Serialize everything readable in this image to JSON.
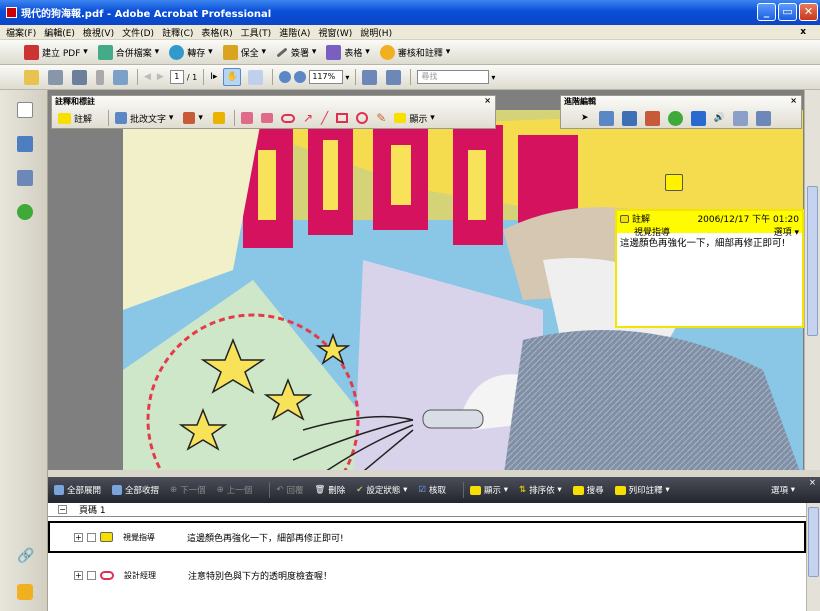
{
  "window": {
    "title": "現代的狗海報.pdf - Adobe Acrobat Professional",
    "close_doc": "x"
  },
  "menu": [
    "檔案(F)",
    "編輯(E)",
    "檢視(V)",
    "文件(D)",
    "註釋(C)",
    "表格(R)",
    "工具(T)",
    "進階(A)",
    "視窗(W)",
    "說明(H)"
  ],
  "toolbar1": {
    "create_pdf": "建立 PDF",
    "combine": "合併檔案",
    "export": "轉存",
    "secure": "保全",
    "sign": "簽署",
    "forms": "表格",
    "review": "審核和註釋"
  },
  "toolbar2": {
    "page_current": "1",
    "page_total": "/ 1",
    "zoom": "117%",
    "search_placeholder": "尋找"
  },
  "comment_toolbar": {
    "title": "註釋和標註",
    "note": "註解",
    "text_edits": "批改文字",
    "show": "顯示"
  },
  "advanced_toolbar": {
    "title": "進階編輯"
  },
  "note": {
    "label": "註解",
    "timestamp": "2006/12/17 下午 01:20",
    "author": "視覺指導",
    "options": "選項",
    "text": "這邊顏色再強化一下，細部再修正即可!"
  },
  "comments_panel": {
    "expand_all": "全部展開",
    "collapse_all": "全部收摺",
    "next": "下一個",
    "previous": "上一個",
    "reply": "回覆",
    "delete": "刪除",
    "set_status": "設定狀態",
    "checkmark": "核取",
    "show": "顯示",
    "sort": "排序依",
    "search": "搜尋",
    "print": "列印註釋",
    "options": "選項",
    "page_label": "頁碼 1",
    "comments": [
      {
        "author": "視覺指導",
        "text": "這邊顏色再強化一下，細部再修正即可!"
      },
      {
        "author": "設計經理",
        "text": "注意特別色與下方的透明度檢查喔！"
      }
    ]
  },
  "colors": {
    "title_blue": "#0b46c6",
    "note_yellow": "#fffb00",
    "poster_pink": "#d5125e",
    "poster_yellow": "#f7e25a",
    "poster_sky": "#8ac7e6",
    "panel_dark": "#2b2d35"
  }
}
